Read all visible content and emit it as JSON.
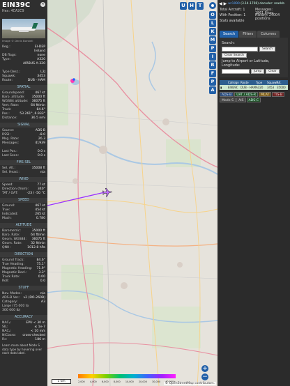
{
  "detail": {
    "callsign": "EIN39C",
    "hex_label": "Hex:",
    "hex": "4CA2C9",
    "photo_credit": "Image © Denis Borstell",
    "top_rows": [
      {
        "k": "Reg.:",
        "v": "EI-DEP"
      },
      {
        "k": "",
        "v": "Ireland"
      },
      {
        "k": "DB flags:",
        "v": "none"
      },
      {
        "k": "Type:",
        "v": "A320"
      },
      {
        "k": "",
        "v": "AIRBUS A-320"
      },
      {
        "k": "",
        "v": ""
      },
      {
        "k": "Type Desc.:",
        "v": "L2J"
      },
      {
        "k": "Squawk:",
        "v": "3453"
      },
      {
        "k": "Route:",
        "v": "DUB - HAM"
      }
    ],
    "sections": [
      {
        "title": "SPATIAL",
        "rows": [
          {
            "k": "Groundspeed:",
            "v": "467 kt"
          },
          {
            "k": "Baro. altitude:",
            "v": "35000 ft"
          },
          {
            "k": "WGS84 altitude:",
            "v": "36075 ft"
          },
          {
            "k": "Vert. Rate:",
            "v": "64 ft/min"
          },
          {
            "k": "Track:",
            "v": "84.6°"
          },
          {
            "k": "Pos.:",
            "v": "53.261°, 6.933°"
          },
          {
            "k": "Distance:",
            "v": "36.5 nmi"
          }
        ]
      },
      {
        "title": "SIGNAL",
        "rows": [
          {
            "k": "Source:",
            "v": "ADS-B"
          },
          {
            "k": "RSSI:",
            "v": "-8.0"
          },
          {
            "k": "Msg. Rate:",
            "v": "26.3"
          },
          {
            "k": "Messages:",
            "v": "41939"
          },
          {
            "k": "",
            "v": ""
          },
          {
            "k": "Last Pos.:",
            "v": "0.0 s"
          },
          {
            "k": "Last Seen:",
            "v": "0.0 s"
          }
        ]
      },
      {
        "title": "FMS SEL",
        "rows": [
          {
            "k": "Sel. Alt.:",
            "v": "35008 ft"
          },
          {
            "k": "Sel. Head.:",
            "v": "n/a"
          }
        ]
      },
      {
        "title": "WIND",
        "rows": [
          {
            "k": "Speed:",
            "v": "77 kt"
          },
          {
            "k": "Direction (from):",
            "v": "340°"
          },
          {
            "k": "TAT / OAT:",
            "v": "-23 / -50 °C"
          }
        ]
      },
      {
        "title": "SPEED",
        "rows": [
          {
            "k": "Ground:",
            "v": "467 kt"
          },
          {
            "k": "True:",
            "v": "454 kt"
          },
          {
            "k": "Indicated:",
            "v": "265 kt"
          },
          {
            "k": "Mach:",
            "v": "0.780"
          }
        ]
      },
      {
        "title": "ALTITUDE",
        "rows": [
          {
            "k": "Barometric:",
            "v": "35000 ft"
          },
          {
            "k": "Baro. Rate:",
            "v": "64 ft/min"
          },
          {
            "k": "Geom. WGS84:",
            "v": "36075 ft"
          },
          {
            "k": "Geom. Rate:",
            "v": "32 ft/min"
          },
          {
            "k": "QNH:",
            "v": "1012.8 hPa"
          }
        ]
      },
      {
        "title": "DIRECTION",
        "rows": [
          {
            "k": "Ground Track:",
            "v": "84.6°"
          },
          {
            "k": "True Heading:",
            "v": "75.1°"
          },
          {
            "k": "Magnetic Heading:",
            "v": "71.9°"
          },
          {
            "k": "Magnetic Decl.:",
            "v": "3.3°"
          },
          {
            "k": "Track Rate:",
            "v": "0.00"
          },
          {
            "k": "Roll:",
            "v": "0.0"
          }
        ]
      },
      {
        "title": "STUFF",
        "rows": [
          {
            "k": "Nav. Modes:",
            "v": "n/a"
          },
          {
            "k": "ADS-B Ver.:",
            "v": "v2 (DO-260B)"
          },
          {
            "k": "Category:",
            "v": "A3"
          },
          {
            "k": "Large (75 000 to",
            "v": ""
          },
          {
            "k": "300 000 lb)",
            "v": ""
          }
        ]
      },
      {
        "title": "ACCURACY",
        "rows": [
          {
            "k": "NACₚ:",
            "v": "EPU < 30 m"
          },
          {
            "k": "SIL:",
            "v": "≤ 1e-7"
          },
          {
            "k": "NACᵥ:",
            "v": "< 10 m/s"
          },
          {
            "k": "NICbaro:",
            "v": "cross-checked"
          },
          {
            "k": "Rc:",
            "v": "186 m"
          }
        ]
      }
    ],
    "footer": "Learn more about Mode S data type by hovering over each data label."
  },
  "map": {
    "top_buttons": [
      "U",
      "H",
      "T"
    ],
    "side_buttons": [
      "O",
      "L",
      "K",
      "M",
      "P",
      "I",
      "R",
      "F",
      "P",
      "A"
    ],
    "zoom_in": "+",
    "zoom_out": "−",
    "scale": "1 km",
    "altitude_ticks": [
      "2,000",
      "4,000",
      "6,000",
      "8,000",
      "10,000",
      "20,000",
      "30,000",
      "40,000+"
    ],
    "attribution": "© OpenStreetMap contributors.",
    "aircraft_label": "EIN39C"
  },
  "panel": {
    "version_link": "wr1090",
    "version": "(3.14.1769) decoder: readsb",
    "stats": {
      "total_label": "Total Aircraft: 1",
      "with_pos_label": "With Position: 1",
      "stats_label": "Stats available",
      "messages_label": "Messages: 1861.8/sec",
      "history_label": "History: 24004 positions"
    },
    "tabs": [
      "Search",
      "Filters",
      "Columns"
    ],
    "search_label": "Search:",
    "search_button": "Search",
    "clear_button": "Clear Search",
    "jump_label": "Jump to Airport or Latitude, Longitude:",
    "jump_button": "Jump",
    "clear2_button": "Clear",
    "columns": [
      "Callsign",
      "Route",
      "Type",
      "Squawk",
      "Alt.",
      "Fl"
    ],
    "row": {
      "callsign": "EIN39C",
      "route": "DUB - HAM",
      "type": "A320",
      "squawk": "3453",
      "alt": "35000"
    },
    "badges": [
      {
        "t": "ADS-B",
        "c": "b-blue"
      },
      {
        "t": "UAT / ADS-R",
        "c": "b-grn"
      },
      {
        "t": "MLAT",
        "c": "b-org"
      },
      {
        "t": "TIS-B",
        "c": "b-red"
      },
      {
        "t": "Mode-S",
        "c": "b-gry"
      },
      {
        "t": "AIS",
        "c": "b-gry"
      },
      {
        "t": "ADS-C",
        "c": "b-grn"
      }
    ]
  }
}
